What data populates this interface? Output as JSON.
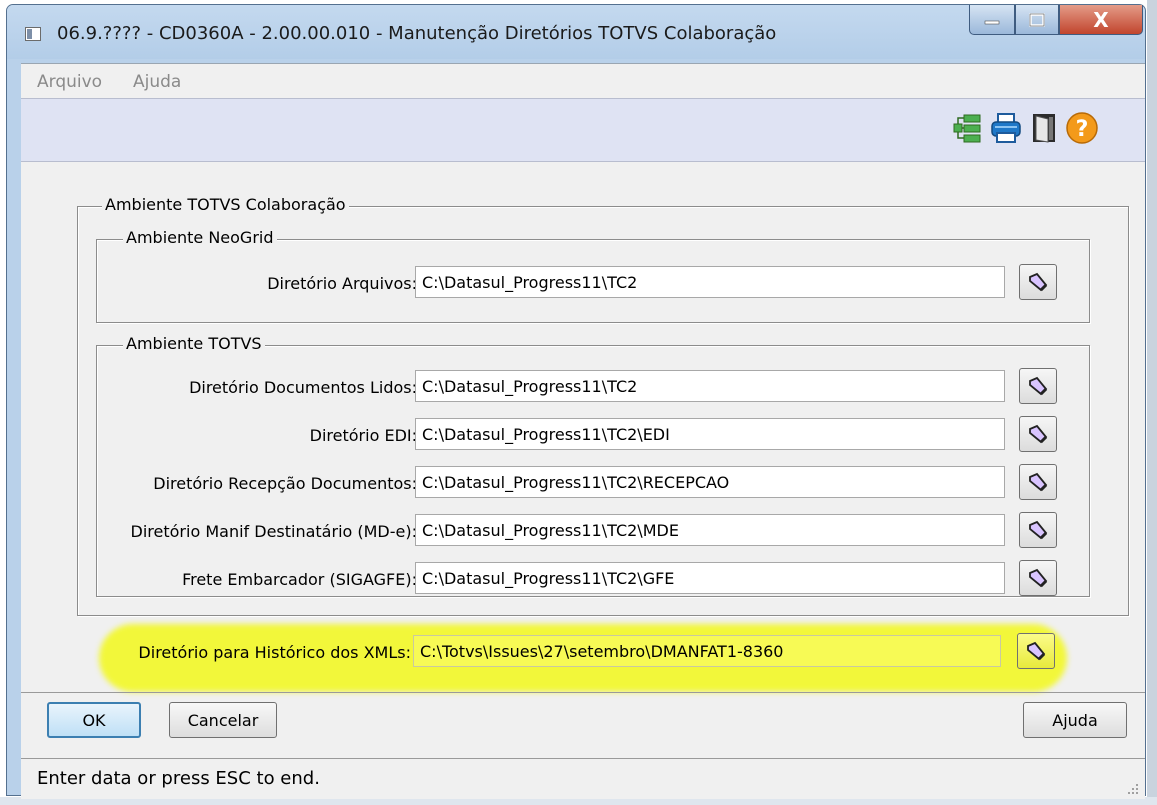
{
  "window": {
    "title": "06.9.???? - CD0360A - 2.00.00.010 - Manutenção Diretórios TOTVS Colaboração",
    "minimize_glyph": "▁",
    "maximize_glyph": "□",
    "close_glyph": "X"
  },
  "menu": {
    "items": [
      "Arquivo",
      "Ajuda"
    ]
  },
  "toolbar": {
    "icons": [
      "tree-icon",
      "printer-icon",
      "exit-door-icon",
      "help-icon"
    ]
  },
  "groups": {
    "main_legend": "Ambiente TOTVS Colaboração",
    "neogrid_legend": "Ambiente NeoGrid",
    "totvs_legend": "Ambiente TOTVS"
  },
  "fields": {
    "arquivos": {
      "label": "Diretório Arquivos:",
      "value": "C:\\Datasul_Progress11\\TC2"
    },
    "lidos": {
      "label": "Diretório Documentos Lidos:",
      "value": "C:\\Datasul_Progress11\\TC2"
    },
    "edi": {
      "label": "Diretório EDI:",
      "value": "C:\\Datasul_Progress11\\TC2\\EDI"
    },
    "recepcao": {
      "label": "Diretório Recepção Documentos:",
      "value": "C:\\Datasul_Progress11\\TC2\\RECEPCAO"
    },
    "mde": {
      "label": "Diretório Manif Destinatário (MD-e):",
      "value": "C:\\Datasul_Progress11\\TC2\\MDE"
    },
    "gfe": {
      "label": "Frete Embarcador (SIGAGFE):",
      "value": "C:\\Datasul_Progress11\\TC2\\GFE"
    },
    "historico": {
      "label": "Diretório para Histórico dos XMLs:",
      "value": "C:\\Totvs\\Issues\\27\\setembro\\DMANFAT1-8360"
    }
  },
  "buttons": {
    "ok": "OK",
    "cancel": "Cancelar",
    "help": "Ajuda"
  },
  "status": {
    "text": "Enter data or press ESC to end."
  },
  "colors": {
    "highlight": "#f2f73a",
    "toolbar": "#dfe3f3",
    "title_bar": "#b9d1ea"
  }
}
